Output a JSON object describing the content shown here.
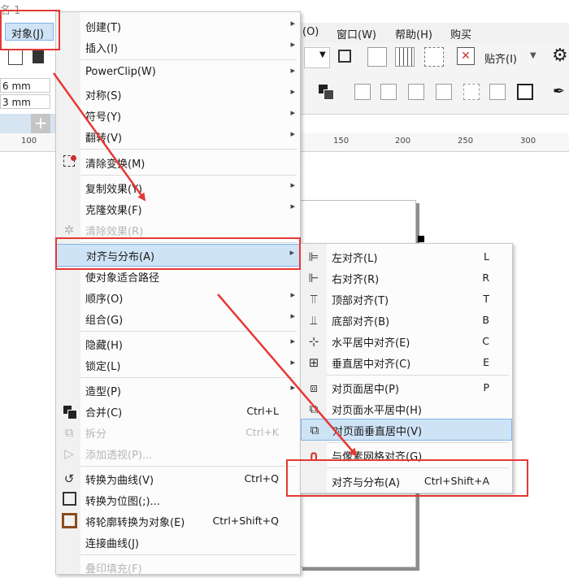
{
  "top_left": {
    "partial_title": "名 1",
    "object_menu_label": "对象(J)"
  },
  "menubar": {
    "items": [
      "(O)",
      "窗口(W)",
      "帮助(H)",
      "购买"
    ]
  },
  "toolbar": {
    "snap_label": "贴齐(I)"
  },
  "props": {
    "width_value": "6 mm",
    "height_value": "3 mm"
  },
  "ruler": {
    "ticks": [
      "100",
      "150",
      "200",
      "250",
      "300"
    ]
  },
  "object_menu": {
    "items": [
      {
        "label": "创建(T)",
        "arrow": "▸"
      },
      {
        "label": "插入(I)",
        "arrow": "▸"
      },
      {
        "label": "PowerClip(W)",
        "arrow": "▸"
      },
      {
        "label": "对称(S)",
        "arrow": "▸"
      },
      {
        "label": "符号(Y)",
        "arrow": "▸"
      },
      {
        "label": "翻转(V)",
        "arrow": "▸"
      },
      {
        "label": "清除变换(M)"
      },
      {
        "label": "复制效果(Y)",
        "arrow": "▸"
      },
      {
        "label": "克隆效果(F)",
        "arrow": "▸"
      },
      {
        "label": "清除效果(R)"
      },
      {
        "label": "对齐与分布(A)",
        "arrow": "▸"
      },
      {
        "label": "使对象适合路径"
      },
      {
        "label": "顺序(O)",
        "arrow": "▸"
      },
      {
        "label": "组合(G)",
        "arrow": "▸"
      },
      {
        "label": "隐藏(H)",
        "arrow": "▸"
      },
      {
        "label": "锁定(L)",
        "arrow": "▸"
      },
      {
        "label": "造型(P)",
        "arrow": "▸"
      },
      {
        "label": "合并(C)",
        "shortcut": "Ctrl+L"
      },
      {
        "label": "拆分",
        "shortcut": "Ctrl+K"
      },
      {
        "label": "添加透视(P)..."
      },
      {
        "label": "转换为曲线(V)",
        "shortcut": "Ctrl+Q"
      },
      {
        "label": "转换为位图(;)..."
      },
      {
        "label": "将轮廓转换为对象(E)",
        "shortcut": "Ctrl+Shift+Q"
      },
      {
        "label": "连接曲线(J)"
      },
      {
        "label": "叠印填充(F)"
      }
    ]
  },
  "align_submenu": {
    "items": [
      {
        "label": "左对齐(L)",
        "shortcut": "L"
      },
      {
        "label": "右对齐(R)",
        "shortcut": "R"
      },
      {
        "label": "顶部对齐(T)",
        "shortcut": "T"
      },
      {
        "label": "底部对齐(B)",
        "shortcut": "B"
      },
      {
        "label": "水平居中对齐(E)",
        "shortcut": "C"
      },
      {
        "label": "垂直居中对齐(C)",
        "shortcut": "E"
      },
      {
        "label": "对页面居中(P)",
        "shortcut": "P"
      },
      {
        "label": "对页面水平居中(H)"
      },
      {
        "label": "对页面垂直居中(V)"
      },
      {
        "label": "与像素网格对齐(G)"
      },
      {
        "label": "对齐与分布(A)",
        "shortcut": "Ctrl+Shift+A"
      }
    ]
  },
  "colors": {
    "highlight": "#cfe3f6",
    "annotation_red": "#e53935",
    "magnet_red": "#d32f2f"
  }
}
